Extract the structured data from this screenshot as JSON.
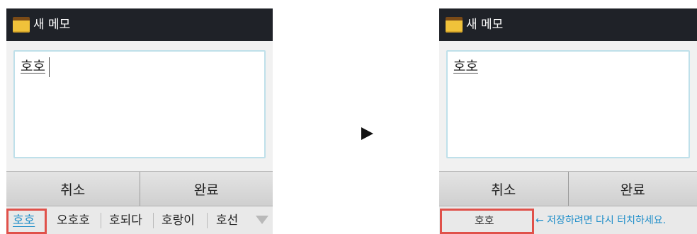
{
  "left": {
    "title": "새 메모",
    "memo_text": "호호",
    "buttons": {
      "cancel": "취소",
      "done": "완료"
    },
    "candidates": [
      "호호",
      "오호호",
      "호되다",
      "호랑이",
      "호선"
    ]
  },
  "right": {
    "title": "새 메모",
    "memo_text": "호호",
    "buttons": {
      "cancel": "취소",
      "done": "완료"
    },
    "candidate": "호호",
    "hint": "← 저장하려면 다시 터치하세요."
  },
  "colors": {
    "titlebar": "#1f2228",
    "highlight": "#e0514a",
    "accent": "#1f8ec9"
  },
  "icons": {
    "memo": "note-icon",
    "more": "chevron-down-icon",
    "step": "play-arrow-icon"
  }
}
